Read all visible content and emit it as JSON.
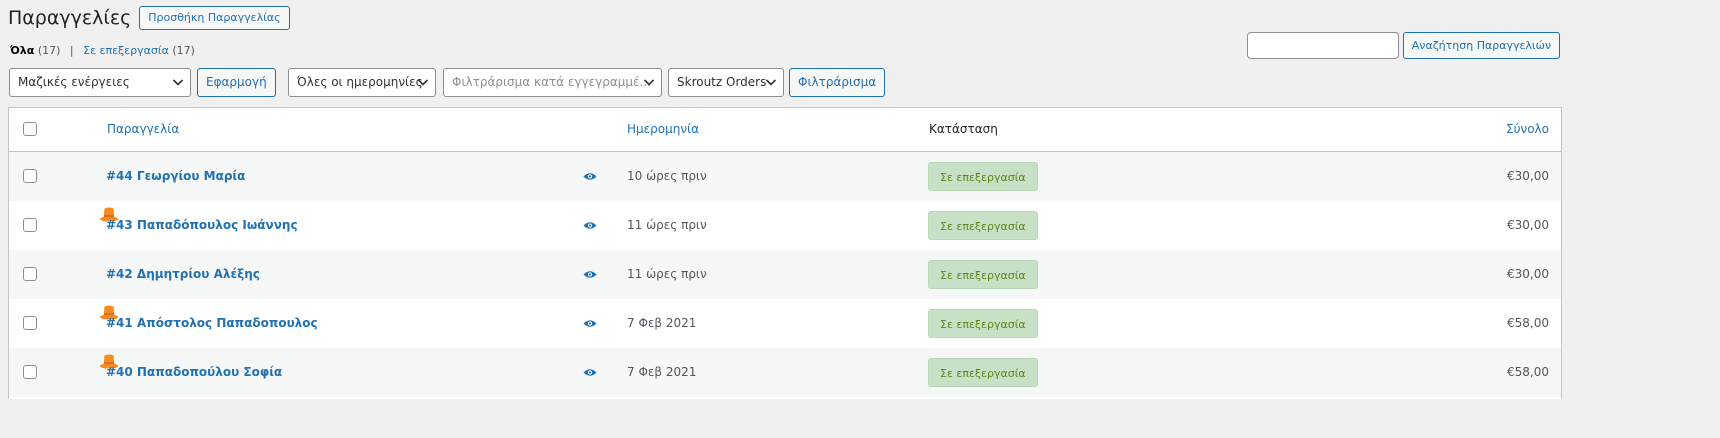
{
  "header": {
    "title": "Παραγγελίες",
    "add_button": "Προσθήκη Παραγγελίας"
  },
  "views": {
    "all_label": "Όλα",
    "all_count": "(17)",
    "processing_label": "Σε επεξεργασία",
    "processing_count": "(17)",
    "separator": "|"
  },
  "search": {
    "value": "",
    "button": "Αναζήτηση Παραγγελιών"
  },
  "filters": {
    "bulk_actions": "Μαζικές ενέργειες",
    "apply": "Εφαρμογή",
    "dates": "Όλες οι ημερομηνίες",
    "customer_placeholder": "Φιλτράρισμα κατά εγγεγραμμέ...",
    "skroutz": "Skroutz Orders",
    "filter_button": "Φιλτράρισμα"
  },
  "table": {
    "columns": {
      "order": "Παραγγελία",
      "date": "Ημερομηνία",
      "status": "Κατάσταση",
      "total": "Σύνολο"
    },
    "rows": [
      {
        "order": "#44 Γεωργίου Μαρία",
        "skroutz": false,
        "date": "10 ώρες πριν",
        "status": "Σε επεξεργασία",
        "total": "€30,00"
      },
      {
        "order": "#43 Παπαδόπουλος Ιωάννης",
        "skroutz": true,
        "date": "11 ώρες πριν",
        "status": "Σε επεξεργασία",
        "total": "€30,00"
      },
      {
        "order": "#42 Δημητρίου Αλέξης",
        "skroutz": false,
        "date": "11 ώρες πριν",
        "status": "Σε επεξεργασία",
        "total": "€30,00"
      },
      {
        "order": "#41 Απόστολος Παπαδοπουλος",
        "skroutz": true,
        "date": "7 Φεβ 2021",
        "status": "Σε επεξεργασία",
        "total": "€58,00"
      },
      {
        "order": "#40 Παπαδοπούλου Σοφία",
        "skroutz": true,
        "date": "7 Φεβ 2021",
        "status": "Σε επεξεργασία",
        "total": "€58,00"
      }
    ]
  },
  "colors": {
    "accent": "#2271b1",
    "status_bg": "#c6e1c6",
    "status_text": "#5b841b",
    "skroutz_icon": "#f68b24"
  }
}
